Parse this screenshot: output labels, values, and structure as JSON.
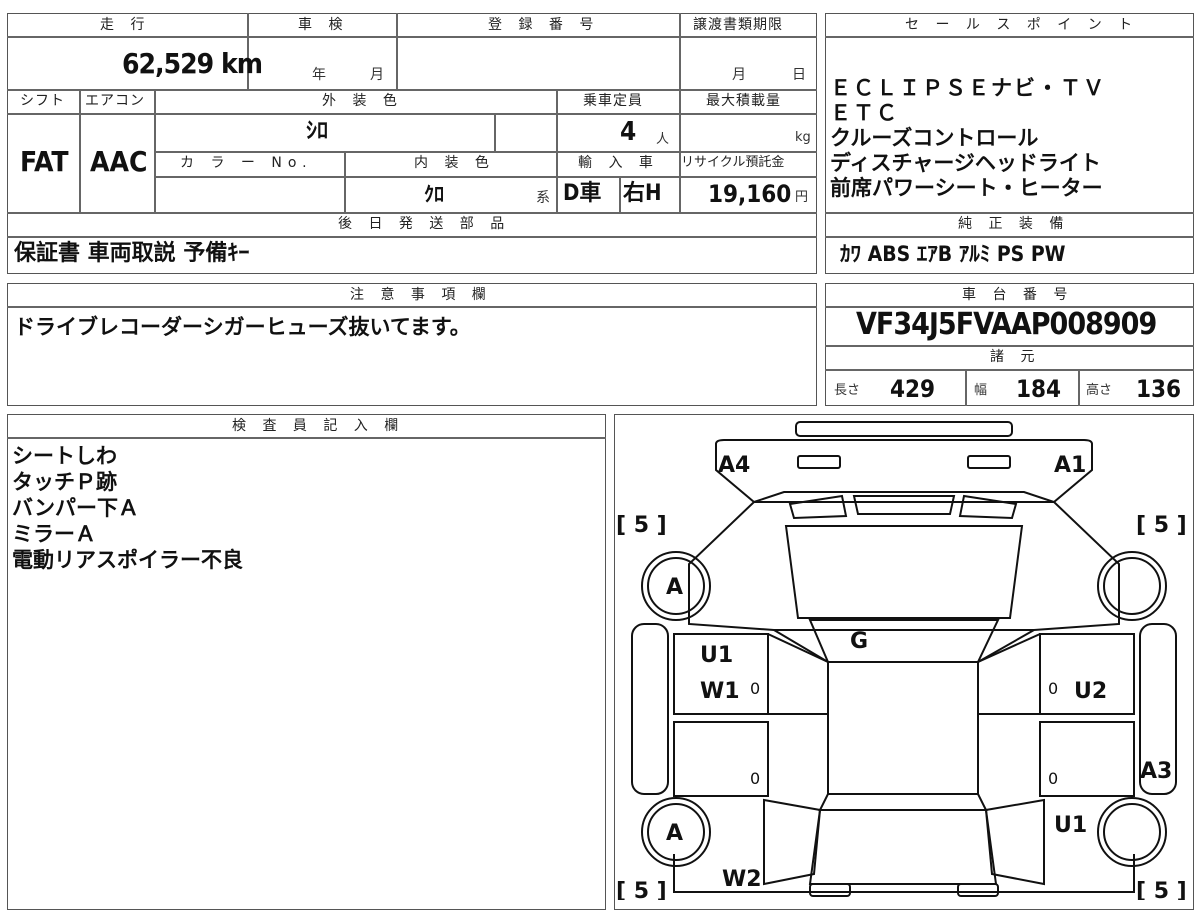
{
  "top_row": {
    "mileage_label": "走 行",
    "shaken_label": "車 検",
    "reg_label": "登 録 番 号",
    "transfer_label": "譲渡書類期限",
    "mileage_value": "62,529 km",
    "shaken_year": "年",
    "shaken_month": "月",
    "transfer_month": "月",
    "transfer_day": "日"
  },
  "mid_row": {
    "shift_label": "シフト",
    "ac_label": "エアコン",
    "ext_color_label": "外 装 色",
    "capacity_label": "乗車定員",
    "max_load_label": "最大積載量",
    "ext_color_value": "ｼﾛ",
    "capacity_value": "4",
    "capacity_unit": "人",
    "max_load_unit": "kg",
    "shift_value": "FAT",
    "ac_value": "AAC",
    "color_no_label": "カ ラ ー No.",
    "int_color_label": "内 装 色",
    "import_label": "輸 入 車",
    "recycle_label": "リサイクル預託金",
    "int_color_value": "ｸﾛ",
    "int_color_suffix": "系",
    "import_drive": "D車",
    "import_handle": "右H",
    "recycle_value": "19,160",
    "recycle_unit": "円"
  },
  "shipping": {
    "label": "後 日 発 送 部 品",
    "value": "保証書 車両取説 予備ｷｰ"
  },
  "notes": {
    "label": "注 意 事 項 欄",
    "value": "ドライブレコーダーシガーヒューズ抜いてます。"
  },
  "sales_points": {
    "label": "セ ー ル ス ポ イ ン ト",
    "items": [
      "ＥＣＬＩＰＳＥナビ・ＴＶ",
      "ＥＴＣ",
      "クルーズコントロール",
      "ディスチャージヘッドライト",
      "前席パワーシート・ヒーター"
    ]
  },
  "equipment": {
    "label": "純 正 装 備",
    "value": "ｶﾜ ABS ｴｱB ｱﾙﾐ PS PW"
  },
  "chassis": {
    "label": "車 台 番 号",
    "value": "VF34J5FVAAP008909",
    "spec_label": "諸 元",
    "length_label": "長さ",
    "length_value": "429",
    "width_label": "幅",
    "width_value": "184",
    "height_label": "高さ",
    "height_value": "136"
  },
  "inspector": {
    "label": "検 査 員 記 入 欄",
    "lines": [
      "シートしわ",
      "タッチＰ跡",
      "バンパー下Ａ",
      "ミラーＡ",
      "電動リアスポイラー不良"
    ]
  },
  "diagram": {
    "marks": {
      "a4": "A4",
      "a1": "A1",
      "five_tl": "[ 5 ]",
      "five_tr": "[ 5 ]",
      "a_top": "A",
      "g": "G",
      "u1_left": "U1",
      "w1": "W1",
      "zero_1": "0",
      "zero_2": "0",
      "u2": "U2",
      "zero_3": "0",
      "zero_4": "0",
      "a3": "A3",
      "a_bottom": "A",
      "u1_right": "U1",
      "w2": "W2",
      "five_bl": "[ 5 ]",
      "five_br": "[ 5 ]"
    }
  }
}
